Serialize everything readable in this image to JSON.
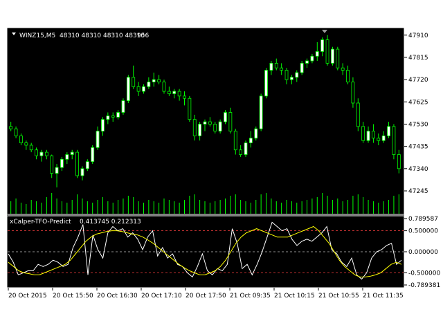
{
  "chart_data": {
    "type": "candlestick",
    "symbol_info": "WINZ15,M5",
    "ohlc_text": "48310 48310 48310 48310",
    "volume_text": "956",
    "colors": {
      "background": "#000000",
      "frame": "#ffffff",
      "bull_body": "#ffffff",
      "wick": "#00ff00",
      "volume": "#00ff00",
      "osc_main": "#ffffff",
      "osc_signal": "#ffff00",
      "level_line": "#c0c0c0",
      "extreme_line": "#ff4040",
      "text": "#ffffff"
    },
    "price_axis": {
      "ticks": [
        "47910",
        "47815",
        "47720",
        "47625",
        "47530",
        "47435",
        "47340",
        "47245"
      ],
      "ylim": [
        47180,
        47930
      ]
    },
    "time_axis": {
      "labels": [
        "20 Oct 2015",
        "20 Oct 15:50",
        "20 Oct 16:30",
        "20 Oct 17:10",
        "20 Oct 17:50",
        "21 Oct 09:35",
        "21 Oct 10:15",
        "21 Oct 10:55",
        "21 Oct 11:35"
      ]
    },
    "candles": [
      [
        47520,
        47540,
        47500,
        47510
      ],
      [
        47510,
        47520,
        47470,
        47480
      ],
      [
        47480,
        47490,
        47440,
        47450
      ],
      [
        47450,
        47460,
        47420,
        47440
      ],
      [
        47440,
        47450,
        47410,
        47420
      ],
      [
        47420,
        47430,
        47380,
        47395
      ],
      [
        47395,
        47420,
        47370,
        47410
      ],
      [
        47410,
        47420,
        47380,
        47395
      ],
      [
        47395,
        47400,
        47300,
        47320
      ],
      [
        47320,
        47360,
        47260,
        47345
      ],
      [
        47345,
        47390,
        47330,
        47380
      ],
      [
        47380,
        47410,
        47360,
        47400
      ],
      [
        47400,
        47420,
        47380,
        47410
      ],
      [
        47410,
        47420,
        47300,
        47310
      ],
      [
        47310,
        47350,
        47290,
        47340
      ],
      [
        47340,
        47380,
        47330,
        47370
      ],
      [
        47370,
        47440,
        47360,
        47430
      ],
      [
        47430,
        47520,
        47420,
        47500
      ],
      [
        47500,
        47560,
        47480,
        47550
      ],
      [
        47550,
        47580,
        47530,
        47565
      ],
      [
        47565,
        47580,
        47540,
        47560
      ],
      [
        47560,
        47590,
        47550,
        47580
      ],
      [
        47580,
        47640,
        47570,
        47630
      ],
      [
        47630,
        47740,
        47620,
        47730
      ],
      [
        47730,
        47780,
        47680,
        47690
      ],
      [
        47690,
        47710,
        47650,
        47670
      ],
      [
        47670,
        47700,
        47660,
        47690
      ],
      [
        47690,
        47730,
        47680,
        47710
      ],
      [
        47710,
        47750,
        47690,
        47720
      ],
      [
        47720,
        47740,
        47700,
        47710
      ],
      [
        47710,
        47720,
        47660,
        47670
      ],
      [
        47670,
        47690,
        47650,
        47660
      ],
      [
        47660,
        47680,
        47640,
        47670
      ],
      [
        47670,
        47680,
        47630,
        47650
      ],
      [
        47650,
        47670,
        47610,
        47640
      ],
      [
        47640,
        47650,
        47540,
        47550
      ],
      [
        47550,
        47570,
        47460,
        47480
      ],
      [
        47480,
        47540,
        47460,
        47530
      ],
      [
        47530,
        47550,
        47500,
        47540
      ],
      [
        47540,
        47560,
        47520,
        47530
      ],
      [
        47530,
        47540,
        47490,
        47500
      ],
      [
        47500,
        47550,
        47490,
        47540
      ],
      [
        47540,
        47590,
        47530,
        47580
      ],
      [
        47580,
        47600,
        47490,
        47500
      ],
      [
        47500,
        47510,
        47400,
        47420
      ],
      [
        47420,
        47440,
        47390,
        47400
      ],
      [
        47400,
        47460,
        47390,
        47450
      ],
      [
        47450,
        47500,
        47430,
        47470
      ],
      [
        47470,
        47520,
        47460,
        47510
      ],
      [
        47510,
        47660,
        47500,
        47650
      ],
      [
        47650,
        47770,
        47640,
        47760
      ],
      [
        47760,
        47800,
        47740,
        47790
      ],
      [
        47790,
        47810,
        47760,
        47770
      ],
      [
        47770,
        47790,
        47740,
        47760
      ],
      [
        47760,
        47770,
        47700,
        47720
      ],
      [
        47720,
        47740,
        47700,
        47730
      ],
      [
        47730,
        47760,
        47710,
        47750
      ],
      [
        47750,
        47800,
        47740,
        47790
      ],
      [
        47790,
        47810,
        47770,
        47800
      ],
      [
        47800,
        47830,
        47790,
        47820
      ],
      [
        47820,
        47880,
        47800,
        47840
      ],
      [
        47840,
        47900,
        47820,
        47890
      ],
      [
        47890,
        47910,
        47780,
        47790
      ],
      [
        47790,
        47860,
        47780,
        47850
      ],
      [
        47850,
        47860,
        47760,
        47770
      ],
      [
        47770,
        47790,
        47740,
        47760
      ],
      [
        47760,
        47780,
        47700,
        47710
      ],
      [
        47710,
        47730,
        47600,
        47620
      ],
      [
        47620,
        47640,
        47500,
        47520
      ],
      [
        47520,
        47540,
        47450,
        47460
      ],
      [
        47460,
        47520,
        47450,
        47500
      ],
      [
        47500,
        47530,
        47450,
        47470
      ],
      [
        47470,
        47490,
        47440,
        47460
      ],
      [
        47460,
        47500,
        47450,
        47480
      ],
      [
        47480,
        47540,
        47470,
        47520
      ],
      [
        47520,
        47530,
        47380,
        47400
      ],
      [
        47400,
        47420,
        47320,
        47340
      ]
    ],
    "volumes": [
      18,
      22,
      16,
      14,
      20,
      18,
      16,
      24,
      30,
      22,
      18,
      16,
      20,
      28,
      22,
      18,
      16,
      20,
      24,
      18,
      16,
      20,
      22,
      26,
      24,
      18,
      16,
      20,
      18,
      16,
      22,
      20,
      18,
      16,
      20,
      26,
      28,
      20,
      18,
      16,
      18,
      20,
      22,
      26,
      28,
      20,
      18,
      16,
      20,
      28,
      30,
      22,
      18,
      16,
      20,
      18,
      16,
      18,
      20,
      22,
      24,
      30,
      26,
      20,
      22,
      18,
      20,
      26,
      28,
      24,
      20,
      18,
      16,
      18,
      20,
      26,
      28
    ],
    "indicator": {
      "name": "xCalper-TFO-Predict",
      "values_text": "0.413745 0.212313",
      "levels": [
        "0.789587",
        "0.500000",
        "0.000000",
        "-0.500000",
        "-0.789381"
      ],
      "ylim": [
        -0.789381,
        0.789587
      ],
      "main": [
        -0.05,
        -0.25,
        -0.55,
        -0.5,
        -0.45,
        -0.45,
        -0.3,
        -0.35,
        -0.3,
        -0.2,
        -0.25,
        -0.35,
        -0.3,
        0.1,
        0.35,
        0.65,
        -0.55,
        0.4,
        0.05,
        -0.15,
        0.45,
        0.6,
        0.5,
        0.55,
        0.35,
        0.45,
        0.3,
        0.05,
        0.35,
        0.5,
        -0.1,
        0.1,
        -0.15,
        -0.05,
        -0.3,
        -0.35,
        -0.5,
        -0.6,
        -0.35,
        -0.05,
        -0.45,
        -0.55,
        -0.4,
        -0.45,
        -0.3,
        0.55,
        0.2,
        -0.4,
        -0.3,
        -0.55,
        -0.3,
        0.0,
        0.35,
        0.7,
        0.6,
        0.5,
        0.55,
        0.3,
        0.15,
        0.25,
        0.3,
        0.25,
        0.35,
        0.45,
        0.6,
        0.05,
        -0.05,
        -0.25,
        -0.35,
        -0.15,
        -0.55,
        -0.65,
        -0.5,
        -0.15,
        0.0,
        0.05,
        0.15,
        0.2,
        -0.3,
        -0.2
      ],
      "signal": [
        -0.25,
        -0.35,
        -0.45,
        -0.5,
        -0.52,
        -0.55,
        -0.55,
        -0.5,
        -0.45,
        -0.4,
        -0.35,
        -0.3,
        -0.2,
        -0.05,
        0.1,
        0.25,
        0.35,
        0.42,
        0.45,
        0.48,
        0.5,
        0.5,
        0.48,
        0.45,
        0.42,
        0.4,
        0.35,
        0.28,
        0.2,
        0.1,
        0.0,
        -0.1,
        -0.2,
        -0.3,
        -0.38,
        -0.45,
        -0.5,
        -0.55,
        -0.55,
        -0.5,
        -0.45,
        -0.35,
        -0.2,
        0.0,
        0.2,
        0.35,
        0.45,
        0.5,
        0.55,
        0.5,
        0.45,
        0.4,
        0.35,
        0.35,
        0.35,
        0.4,
        0.45,
        0.5,
        0.55,
        0.6,
        0.5,
        0.35,
        0.2,
        0.0,
        -0.2,
        -0.35,
        -0.45,
        -0.55,
        -0.6,
        -0.6,
        -0.58,
        -0.55,
        -0.5,
        -0.4,
        -0.3,
        -0.25,
        -0.3
      ]
    }
  }
}
